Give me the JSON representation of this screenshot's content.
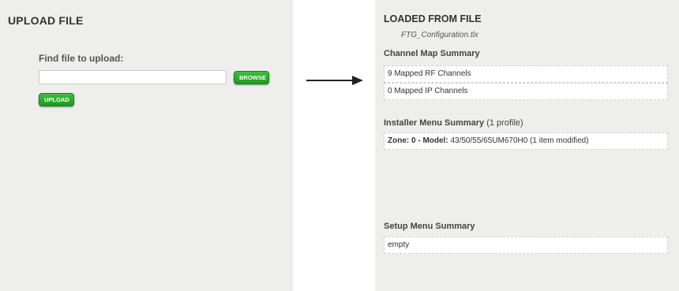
{
  "upload": {
    "title": "UPLOAD FILE",
    "find_label": "Find file to upload:",
    "file_value": "",
    "browse_label": "BROWSE",
    "upload_label": "UPLOAD"
  },
  "loaded": {
    "title": "LOADED FROM FILE",
    "file_name": "FTG_Configuration.tlx",
    "channel_map": {
      "heading": "Channel Map Summary",
      "items": [
        "9 Mapped RF Channels",
        "0 Mapped IP Channels"
      ]
    },
    "installer_menu": {
      "heading": "Installer Menu Summary",
      "profile_count": "(1 profile)",
      "zone_label": "Zone: 0 - Model:",
      "zone_detail": "43/50/55/65UM670H0 (1 item modified)"
    },
    "setup_menu": {
      "heading": "Setup Menu Summary",
      "value": "empty"
    }
  },
  "colors": {
    "panel_bg": "#eeeeed",
    "button_green": "#2aa92a",
    "text": "#333333"
  },
  "icons": {
    "arrow": "arrow-right-icon"
  }
}
